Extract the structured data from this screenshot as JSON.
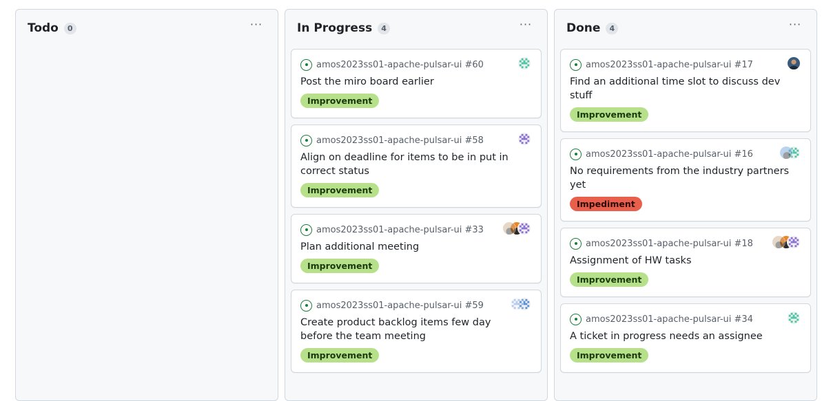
{
  "columns": [
    {
      "title": "Todo",
      "count": "0",
      "menu_label": "···",
      "cards": []
    },
    {
      "title": "In Progress",
      "count": "4",
      "menu_label": "···",
      "cards": [
        {
          "repo": "amos2023ss01-apache-pulsar-ui #60",
          "title": "Post the miro board earlier",
          "label": "Improvement",
          "label_type": "improvement",
          "avatars": [
            {
              "kind": "identicon-green",
              "color": "#4cc7a5"
            }
          ]
        },
        {
          "repo": "amos2023ss01-apache-pulsar-ui #58",
          "title": "Align on deadline for items to be in put in correct status",
          "label": "Improvement",
          "label_type": "improvement",
          "avatars": [
            {
              "kind": "identicon-purple",
              "color": "#8a6fd6"
            }
          ]
        },
        {
          "repo": "amos2023ss01-apache-pulsar-ui #33",
          "title": "Plan additional meeting",
          "label": "Improvement",
          "label_type": "improvement",
          "avatars": [
            {
              "kind": "identicon-purple",
              "color": "#8a6fd6"
            },
            {
              "kind": "photo-orange",
              "color": "#e8862a"
            },
            {
              "kind": "photo-faded",
              "color": "#c9a98a"
            }
          ]
        },
        {
          "repo": "amos2023ss01-apache-pulsar-ui #59",
          "title": "Create product backlog items few day before the team meeting",
          "label": "Improvement",
          "label_type": "improvement",
          "avatars": [
            {
              "kind": "identicon-blue",
              "color": "#5a8fd8"
            },
            {
              "kind": "identicon-blue-faded",
              "color": "#5a8fd8"
            }
          ]
        }
      ]
    },
    {
      "title": "Done",
      "count": "4",
      "menu_label": "···",
      "cards": [
        {
          "repo": "amos2023ss01-apache-pulsar-ui #17",
          "title": "Find an additional time slot to discuss dev stuff",
          "label": "Improvement",
          "label_type": "improvement",
          "avatars": [
            {
              "kind": "photo-person",
              "color": "#2f4a6b"
            }
          ]
        },
        {
          "repo": "amos2023ss01-apache-pulsar-ui #16",
          "title": "No requirements from the industry partners yet",
          "label": "Impediment",
          "label_type": "impediment",
          "avatars": [
            {
              "kind": "identicon-green",
              "color": "#4cc7a5"
            },
            {
              "kind": "photo-faded-blue",
              "color": "#6a9fd8"
            }
          ]
        },
        {
          "repo": "amos2023ss01-apache-pulsar-ui #18",
          "title": "Assignment of HW tasks",
          "label": "Improvement",
          "label_type": "improvement",
          "avatars": [
            {
              "kind": "identicon-purple",
              "color": "#8a6fd6"
            },
            {
              "kind": "photo-orange",
              "color": "#e8862a"
            },
            {
              "kind": "photo-faded",
              "color": "#c9a98a"
            }
          ]
        },
        {
          "repo": "amos2023ss01-apache-pulsar-ui #34",
          "title": "A ticket in progress needs an assignee",
          "label": "Improvement",
          "label_type": "improvement",
          "avatars": [
            {
              "kind": "identicon-green",
              "color": "#4cc7a5"
            }
          ]
        }
      ]
    }
  ]
}
